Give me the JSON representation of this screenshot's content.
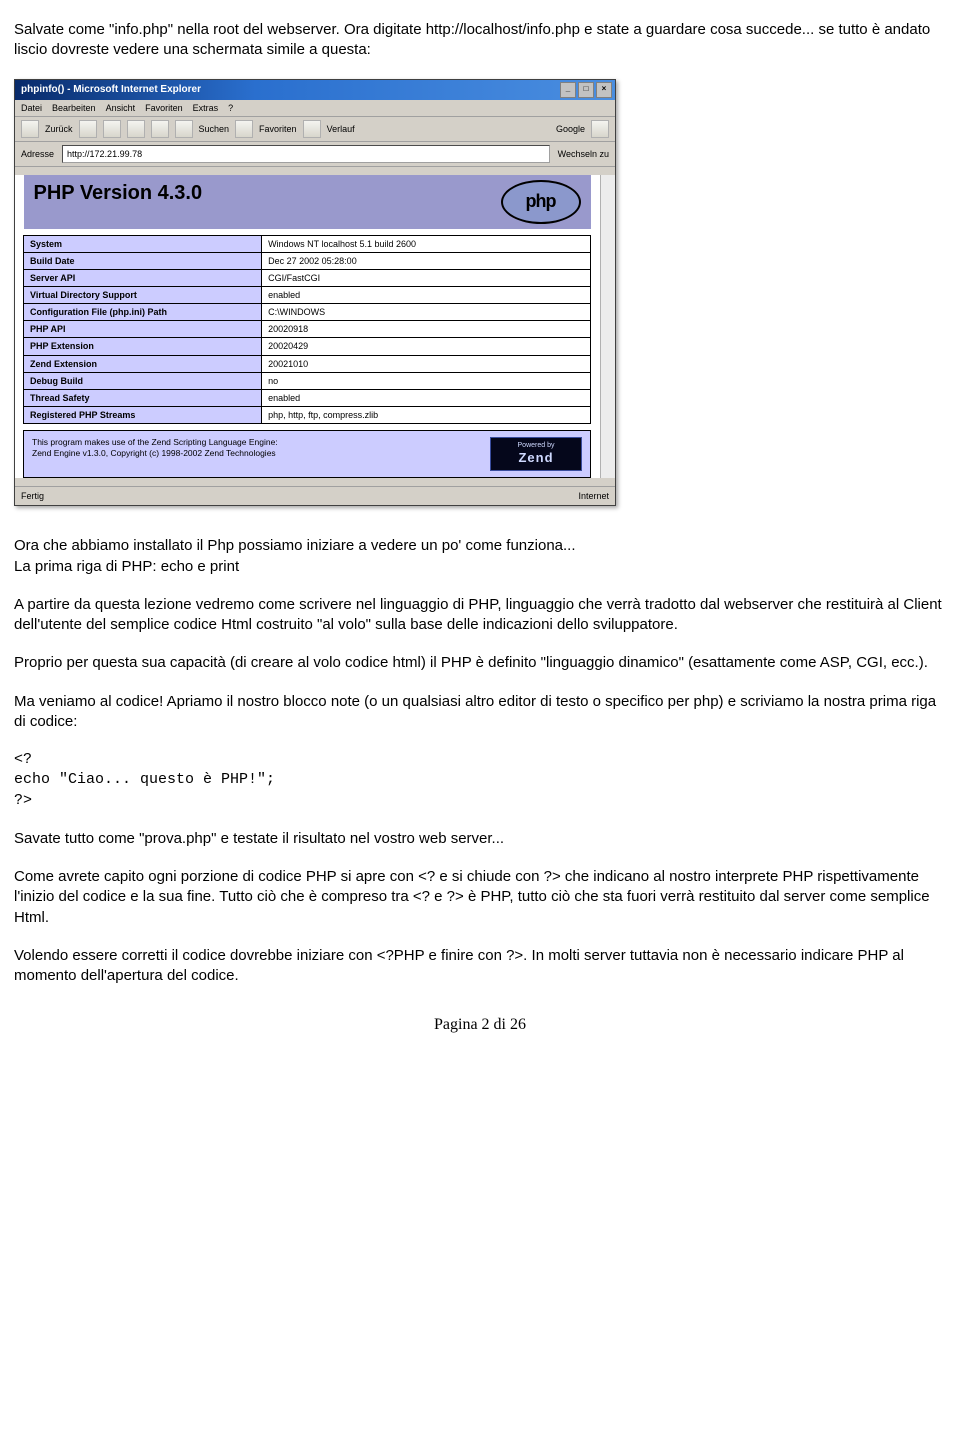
{
  "p1": "Salvate come \"info.php\" nella root del webserver. Ora digitate http://localhost/info.php e state a guardare cosa succede... se tutto è andato liscio dovreste vedere una schermata simile a questa:",
  "browser": {
    "title": "phpinfo() - Microsoft Internet Explorer",
    "menu": [
      "Datei",
      "Bearbeiten",
      "Ansicht",
      "Favoriten",
      "Extras",
      "?"
    ],
    "toolbar": {
      "back": "Zurück",
      "search": "Suchen",
      "fav": "Favoriten",
      "history": "Verlauf",
      "google": "Google"
    },
    "address_label": "Adresse",
    "address_url": "http://172.21.99.78",
    "go": "Wechseln zu",
    "status_left": "Fertig",
    "status_right": "Internet"
  },
  "phpinfo": {
    "version_header": "PHP Version 4.3.0",
    "rows": [
      {
        "k": "System",
        "v": "Windows NT localhost 5.1 build 2600"
      },
      {
        "k": "Build Date",
        "v": "Dec 27 2002 05:28:00"
      },
      {
        "k": "Server API",
        "v": "CGI/FastCGI"
      },
      {
        "k": "Virtual Directory Support",
        "v": "enabled"
      },
      {
        "k": "Configuration File (php.ini) Path",
        "v": "C:\\WINDOWS"
      },
      {
        "k": "PHP API",
        "v": "20020918"
      },
      {
        "k": "PHP Extension",
        "v": "20020429"
      },
      {
        "k": "Zend Extension",
        "v": "20021010"
      },
      {
        "k": "Debug Build",
        "v": "no"
      },
      {
        "k": "Thread Safety",
        "v": "enabled"
      },
      {
        "k": "Registered PHP Streams",
        "v": "php, http, ftp, compress.zlib"
      }
    ],
    "zend": {
      "line1": "This program makes use of the Zend Scripting Language Engine:",
      "line2": "Zend Engine v1.3.0, Copyright (c) 1998-2002 Zend Technologies",
      "badge_top": "Powered by",
      "badge_main": "Zend"
    }
  },
  "p2": "Ora che abbiamo installato il Php possiamo iniziare a vedere un po' come funziona...",
  "p3": "La prima riga di PHP: echo e print",
  "p4": "A partire da questa lezione vedremo come scrivere nel linguaggio di PHP, linguaggio che verrà tradotto dal webserver che restituirà al Client dell'utente del semplice codice Html costruito \"al volo\" sulla base delle indicazioni dello sviluppatore.",
  "p5": "Proprio per questa sua capacità (di creare al volo codice html) il PHP è definito \"linguaggio dinamico\" (esattamente come ASP, CGI, ecc.).",
  "p6": "Ma veniamo al codice! Apriamo il nostro blocco note (o un qualsiasi altro editor di testo o specifico per php) e scriviamo la nostra prima riga di codice:",
  "code": {
    "l1": "<?",
    "l2": "echo \"Ciao... questo è PHP!\";",
    "l3": "?>"
  },
  "p7": "Savate tutto come \"prova.php\" e testate il risultato nel vostro web server...",
  "p8": "Come avrete capito ogni porzione di codice PHP si apre con <? e si chiude con ?> che indicano al nostro interprete PHP rispettivamente l'inizio del codice e la sua fine. Tutto ciò che è compreso tra <? e ?> è PHP, tutto ciò che sta fuori verrà restituito dal server come semplice Html.",
  "p9": "Volendo essere corretti il codice dovrebbe iniziare con <?PHP e finire con ?>. In molti server tuttavia non è necessario indicare PHP al momento dell'apertura del codice.",
  "footer": "Pagina 2 di 26"
}
